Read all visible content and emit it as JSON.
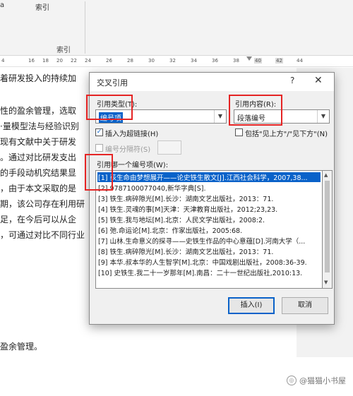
{
  "ribbon": {
    "btn_left": "a",
    "btn_index": "索引",
    "group_index": "索引"
  },
  "ruler": {
    "ticks": [
      "4",
      "16",
      "18",
      "20",
      "22",
      "24",
      "26",
      "28",
      "30",
      "32",
      "34",
      "36",
      "38",
      "40",
      "42",
      "44"
    ]
  },
  "document": {
    "lines": [
      "着研发投入的持续加",
      "性的盈余管理，选取",
      "·量模型法与经验识别",
      "现有文献中关于研发",
      "。通过对比研发支出",
      "的手段动机究结果显",
      "，由于本文采取的是",
      "期，该公司存在利用研",
      "足，在今后可以从企",
      "，可通过对比不同行业",
      "盈余管理。"
    ]
  },
  "dialog": {
    "title": "交叉引用",
    "help": "?",
    "close": "✕",
    "ref_type_label": "引用类型(T):",
    "ref_type_value": "编号项",
    "ref_content_label": "引用内容(R):",
    "ref_content_value": "段落编号",
    "insert_hyperlink_label": "插入为超链接(H)",
    "include_above_below_label": "包括\"见上方\"/\"见下方\"(N)",
    "separator_label": "编号分隔符(S)",
    "which_item_label": "引用哪一个编号项(W):",
    "items": [
      "[1] 荻生命由梦想展开——论史铁生散文[J].江西社会科学，2007,38...",
      "[2] 9787100077040,新华字典[S].",
      "[3] 铁生.病碎隙光[M].长沙：湖南文艺出版社，2013：71.",
      "[4] 铁生.灵魂的事[M]天津：天津教育出版社，2012;23,23.",
      "[5] 铁生.我与地坛[M].北京：人民文学出版社，2008:2.",
      "[6] 弛.命运论[M].北京：作家出版社，2005:68.",
      "[7] 山林.生命意义的探寻——史铁生作品的中心意蕴[D].河南大学（...",
      "[8] 铁生.病碎隙光[M].长沙：湖南文艺出版社，2013：71.",
      "[9] 本华.叔本华的人生智学[M].北京：中国戏剧出版社，2008:36-39.",
      "[10] 史铁生.我二十一岁那年[M].南昌：二十一世纪出版社,2010:13."
    ],
    "insert_button": "插入(I)",
    "cancel_button": "取消"
  },
  "watermark": {
    "text": "@猫猫小书屋"
  },
  "colors": {
    "accent": "#0a62c9",
    "highlight_box": "#e52424"
  }
}
